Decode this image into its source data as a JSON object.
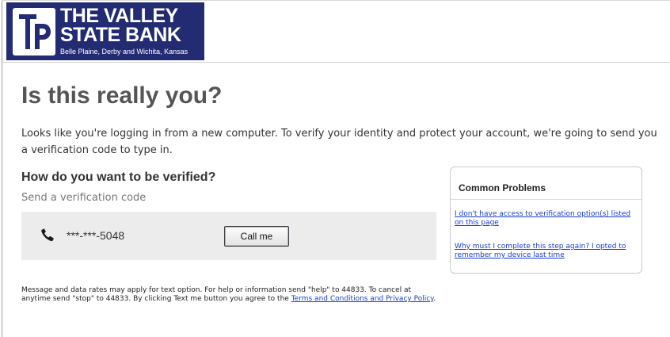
{
  "bank": {
    "name_line1": "THE VALLEY",
    "name_line2": "STATE BANK",
    "tagline": "Belle Plaine, Derby and Wichita, Kansas",
    "brand_color": "#232c73"
  },
  "page": {
    "title": "Is this really you?",
    "intro": "Looks like you're logging in from a new computer. To verify your identity and protect your account, we're going to send you a verification code to type in."
  },
  "verification": {
    "heading": "How do you want to be verified?",
    "send_label": "Send a verification code",
    "phone_icon": "phone-icon",
    "phone_number": "***-***-5048",
    "call_button": "Call me"
  },
  "disclaimer": {
    "text": "Message and data rates may apply for text option. For help or information send \"help\" to 44833. To cancel at anytime send \"stop\" to 44833. By clicking Text me button you agree to the ",
    "link_text": "Terms and Conditions and Privacy Policy",
    "trailing": ".",
    "link_color": "#1a3cc8"
  },
  "common_problems": {
    "title": "Common Problems",
    "links": [
      "I don't have access to verification option(s) listed on this page",
      "Why must I complete this step again? I opted to remember my device last time"
    ]
  }
}
